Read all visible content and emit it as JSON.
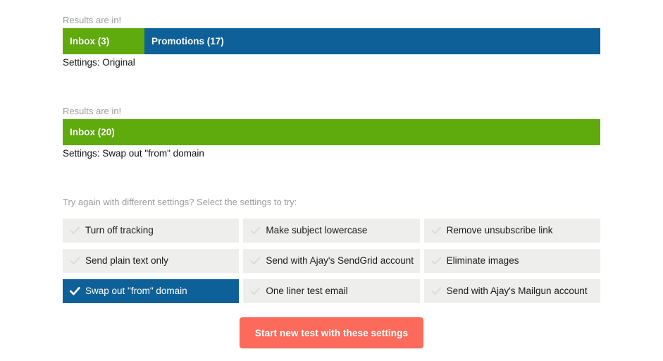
{
  "results": [
    {
      "caption": "Results are in!",
      "settings_line": "Settings: Original",
      "segments": [
        {
          "label": "Inbox (3)",
          "value": 3,
          "color": "#5faa0d",
          "width_pct": 15.2
        },
        {
          "label": "Promotions (17)",
          "value": 17,
          "color": "#0d6198",
          "width_pct": 84.8
        }
      ]
    },
    {
      "caption": "Results are in!",
      "settings_line": "Settings: Swap out \"from\" domain",
      "segments": [
        {
          "label": "Inbox (20)",
          "value": 20,
          "color": "#5faa0d",
          "width_pct": 100
        }
      ]
    }
  ],
  "chooser": {
    "prompt": "Try again with different settings? Select the settings to try:",
    "options": [
      {
        "label": "Turn off tracking",
        "selected": false
      },
      {
        "label": "Make subject lowercase",
        "selected": false
      },
      {
        "label": "Remove unsubscribe link",
        "selected": false
      },
      {
        "label": "Send plain text only",
        "selected": false
      },
      {
        "label": "Send with Ajay's SendGrid account",
        "selected": false
      },
      {
        "label": "Eliminate images",
        "selected": false
      },
      {
        "label": "Swap out \"from\" domain",
        "selected": true
      },
      {
        "label": "One liner test email",
        "selected": false
      },
      {
        "label": "Send with Ajay's Mailgun account",
        "selected": false
      }
    ]
  },
  "submit": {
    "label": "Start new test with these settings"
  },
  "colors": {
    "inbox_green": "#5faa0d",
    "promotions_blue": "#0d6198",
    "selected_blue": "#0d6198",
    "tile_gray": "#eeeeec",
    "check_gray": "#dcdcda",
    "submit_coral": "#fb6a5b",
    "caption_gray": "#9b9b9b"
  }
}
